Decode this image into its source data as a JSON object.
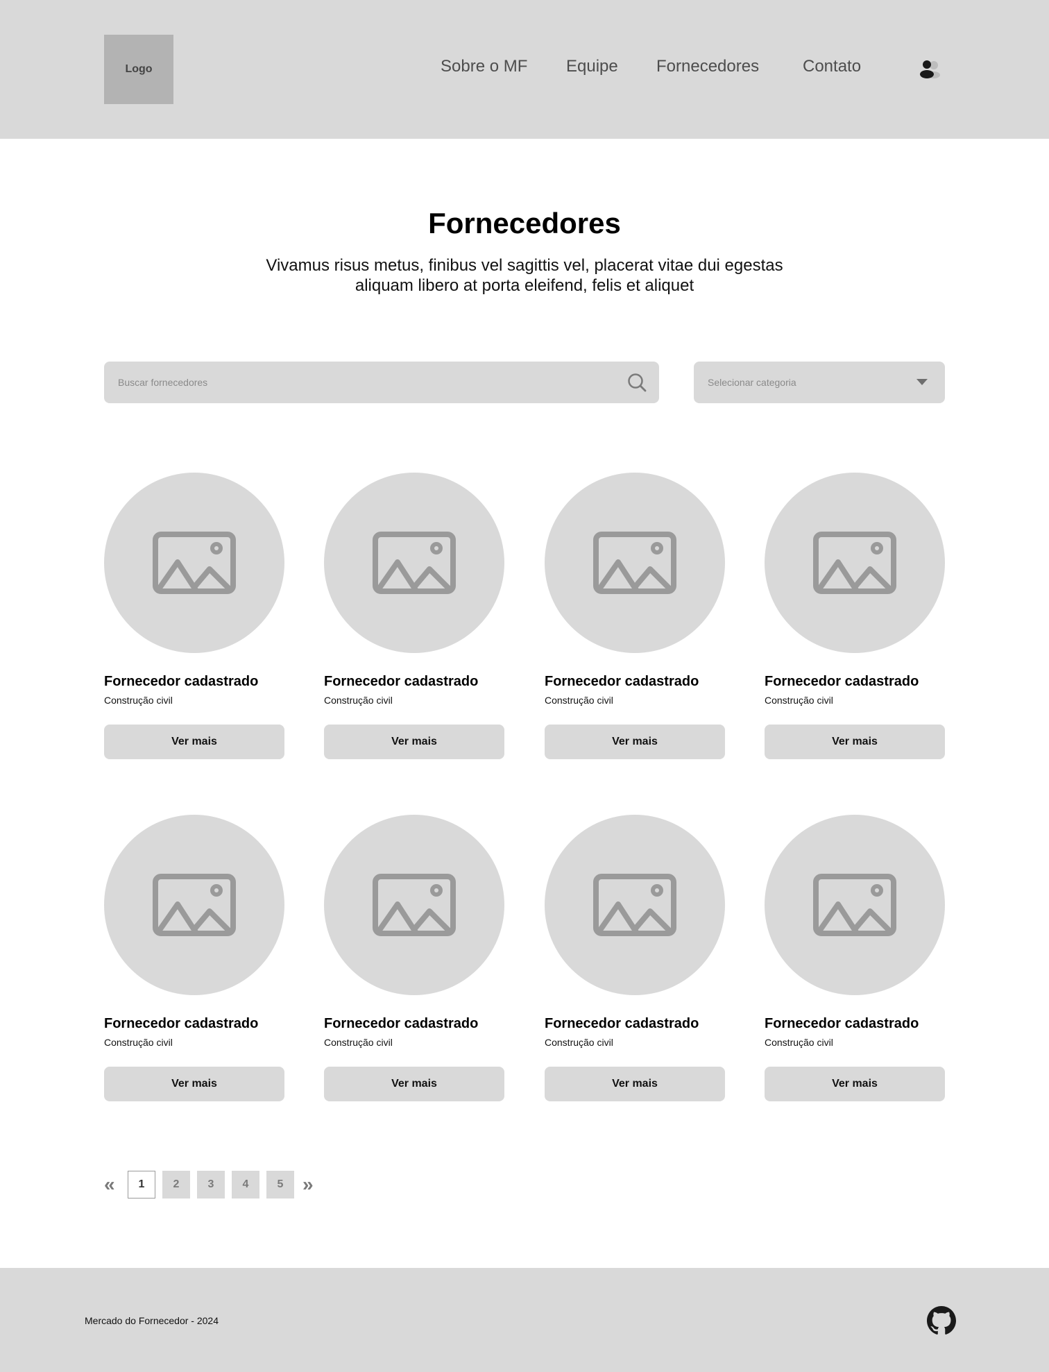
{
  "header": {
    "logo_text": "Logo",
    "nav": [
      "Sobre o MF",
      "Equipe",
      "Fornecedores",
      "Contato"
    ]
  },
  "main": {
    "title": "Fornecedores",
    "subtitle": "Vivamus risus metus, finibus vel sagittis vel, placerat vitae dui egestas aliquam libero at porta eleifend, felis et aliquet"
  },
  "filters": {
    "search_placeholder": "Buscar fornecedores",
    "category_placeholder": "Selecionar categoria"
  },
  "cards": [
    {
      "name": "Fornecedor cadastrado",
      "category": "Construção civil",
      "button": "Ver mais"
    },
    {
      "name": "Fornecedor cadastrado",
      "category": "Construção civil",
      "button": "Ver mais"
    },
    {
      "name": "Fornecedor cadastrado",
      "category": "Construção civil",
      "button": "Ver mais"
    },
    {
      "name": "Fornecedor cadastrado",
      "category": "Construção civil",
      "button": "Ver mais"
    },
    {
      "name": "Fornecedor cadastrado",
      "category": "Construção civil",
      "button": "Ver mais"
    },
    {
      "name": "Fornecedor cadastrado",
      "category": "Construção civil",
      "button": "Ver mais"
    },
    {
      "name": "Fornecedor cadastrado",
      "category": "Construção civil",
      "button": "Ver mais"
    },
    {
      "name": "Fornecedor cadastrado",
      "category": "Construção civil",
      "button": "Ver mais"
    }
  ],
  "pagination": {
    "prev_symbol": "«",
    "next_symbol": "»",
    "pages": [
      "1",
      "2",
      "3",
      "4",
      "5"
    ],
    "current": "1"
  },
  "footer": {
    "text": "Mercado do Fornecedor - 2024"
  },
  "icons": {
    "user": "user-group-icon",
    "search": "search-icon",
    "dropdown": "caret-down-icon",
    "image": "image-placeholder-icon",
    "github": "github-icon"
  },
  "colors": {
    "panel": "#d9d9d9",
    "logo_box": "#b3b3b3",
    "nav_text": "#4d4d4d",
    "icon_gray": "#9a9a9a"
  }
}
